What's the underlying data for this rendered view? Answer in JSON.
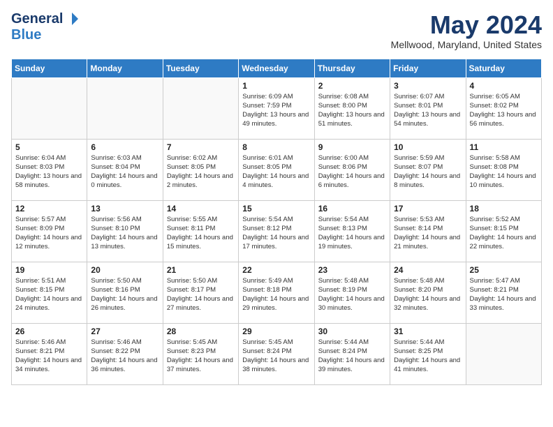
{
  "header": {
    "logo_general": "General",
    "logo_blue": "Blue",
    "month": "May 2024",
    "location": "Mellwood, Maryland, United States"
  },
  "days_of_week": [
    "Sunday",
    "Monday",
    "Tuesday",
    "Wednesday",
    "Thursday",
    "Friday",
    "Saturday"
  ],
  "weeks": [
    {
      "days": [
        {
          "num": "",
          "empty": true
        },
        {
          "num": "",
          "empty": true
        },
        {
          "num": "",
          "empty": true
        },
        {
          "num": "1",
          "sunrise": "Sunrise: 6:09 AM",
          "sunset": "Sunset: 7:59 PM",
          "daylight": "Daylight: 13 hours and 49 minutes."
        },
        {
          "num": "2",
          "sunrise": "Sunrise: 6:08 AM",
          "sunset": "Sunset: 8:00 PM",
          "daylight": "Daylight: 13 hours and 51 minutes."
        },
        {
          "num": "3",
          "sunrise": "Sunrise: 6:07 AM",
          "sunset": "Sunset: 8:01 PM",
          "daylight": "Daylight: 13 hours and 54 minutes."
        },
        {
          "num": "4",
          "sunrise": "Sunrise: 6:05 AM",
          "sunset": "Sunset: 8:02 PM",
          "daylight": "Daylight: 13 hours and 56 minutes."
        }
      ]
    },
    {
      "days": [
        {
          "num": "5",
          "sunrise": "Sunrise: 6:04 AM",
          "sunset": "Sunset: 8:03 PM",
          "daylight": "Daylight: 13 hours and 58 minutes."
        },
        {
          "num": "6",
          "sunrise": "Sunrise: 6:03 AM",
          "sunset": "Sunset: 8:04 PM",
          "daylight": "Daylight: 14 hours and 0 minutes."
        },
        {
          "num": "7",
          "sunrise": "Sunrise: 6:02 AM",
          "sunset": "Sunset: 8:05 PM",
          "daylight": "Daylight: 14 hours and 2 minutes."
        },
        {
          "num": "8",
          "sunrise": "Sunrise: 6:01 AM",
          "sunset": "Sunset: 8:05 PM",
          "daylight": "Daylight: 14 hours and 4 minutes."
        },
        {
          "num": "9",
          "sunrise": "Sunrise: 6:00 AM",
          "sunset": "Sunset: 8:06 PM",
          "daylight": "Daylight: 14 hours and 6 minutes."
        },
        {
          "num": "10",
          "sunrise": "Sunrise: 5:59 AM",
          "sunset": "Sunset: 8:07 PM",
          "daylight": "Daylight: 14 hours and 8 minutes."
        },
        {
          "num": "11",
          "sunrise": "Sunrise: 5:58 AM",
          "sunset": "Sunset: 8:08 PM",
          "daylight": "Daylight: 14 hours and 10 minutes."
        }
      ]
    },
    {
      "days": [
        {
          "num": "12",
          "sunrise": "Sunrise: 5:57 AM",
          "sunset": "Sunset: 8:09 PM",
          "daylight": "Daylight: 14 hours and 12 minutes."
        },
        {
          "num": "13",
          "sunrise": "Sunrise: 5:56 AM",
          "sunset": "Sunset: 8:10 PM",
          "daylight": "Daylight: 14 hours and 13 minutes."
        },
        {
          "num": "14",
          "sunrise": "Sunrise: 5:55 AM",
          "sunset": "Sunset: 8:11 PM",
          "daylight": "Daylight: 14 hours and 15 minutes."
        },
        {
          "num": "15",
          "sunrise": "Sunrise: 5:54 AM",
          "sunset": "Sunset: 8:12 PM",
          "daylight": "Daylight: 14 hours and 17 minutes."
        },
        {
          "num": "16",
          "sunrise": "Sunrise: 5:54 AM",
          "sunset": "Sunset: 8:13 PM",
          "daylight": "Daylight: 14 hours and 19 minutes."
        },
        {
          "num": "17",
          "sunrise": "Sunrise: 5:53 AM",
          "sunset": "Sunset: 8:14 PM",
          "daylight": "Daylight: 14 hours and 21 minutes."
        },
        {
          "num": "18",
          "sunrise": "Sunrise: 5:52 AM",
          "sunset": "Sunset: 8:15 PM",
          "daylight": "Daylight: 14 hours and 22 minutes."
        }
      ]
    },
    {
      "days": [
        {
          "num": "19",
          "sunrise": "Sunrise: 5:51 AM",
          "sunset": "Sunset: 8:15 PM",
          "daylight": "Daylight: 14 hours and 24 minutes."
        },
        {
          "num": "20",
          "sunrise": "Sunrise: 5:50 AM",
          "sunset": "Sunset: 8:16 PM",
          "daylight": "Daylight: 14 hours and 26 minutes."
        },
        {
          "num": "21",
          "sunrise": "Sunrise: 5:50 AM",
          "sunset": "Sunset: 8:17 PM",
          "daylight": "Daylight: 14 hours and 27 minutes."
        },
        {
          "num": "22",
          "sunrise": "Sunrise: 5:49 AM",
          "sunset": "Sunset: 8:18 PM",
          "daylight": "Daylight: 14 hours and 29 minutes."
        },
        {
          "num": "23",
          "sunrise": "Sunrise: 5:48 AM",
          "sunset": "Sunset: 8:19 PM",
          "daylight": "Daylight: 14 hours and 30 minutes."
        },
        {
          "num": "24",
          "sunrise": "Sunrise: 5:48 AM",
          "sunset": "Sunset: 8:20 PM",
          "daylight": "Daylight: 14 hours and 32 minutes."
        },
        {
          "num": "25",
          "sunrise": "Sunrise: 5:47 AM",
          "sunset": "Sunset: 8:21 PM",
          "daylight": "Daylight: 14 hours and 33 minutes."
        }
      ]
    },
    {
      "days": [
        {
          "num": "26",
          "sunrise": "Sunrise: 5:46 AM",
          "sunset": "Sunset: 8:21 PM",
          "daylight": "Daylight: 14 hours and 34 minutes."
        },
        {
          "num": "27",
          "sunrise": "Sunrise: 5:46 AM",
          "sunset": "Sunset: 8:22 PM",
          "daylight": "Daylight: 14 hours and 36 minutes."
        },
        {
          "num": "28",
          "sunrise": "Sunrise: 5:45 AM",
          "sunset": "Sunset: 8:23 PM",
          "daylight": "Daylight: 14 hours and 37 minutes."
        },
        {
          "num": "29",
          "sunrise": "Sunrise: 5:45 AM",
          "sunset": "Sunset: 8:24 PM",
          "daylight": "Daylight: 14 hours and 38 minutes."
        },
        {
          "num": "30",
          "sunrise": "Sunrise: 5:44 AM",
          "sunset": "Sunset: 8:24 PM",
          "daylight": "Daylight: 14 hours and 39 minutes."
        },
        {
          "num": "31",
          "sunrise": "Sunrise: 5:44 AM",
          "sunset": "Sunset: 8:25 PM",
          "daylight": "Daylight: 14 hours and 41 minutes."
        },
        {
          "num": "",
          "empty": true
        }
      ]
    }
  ]
}
